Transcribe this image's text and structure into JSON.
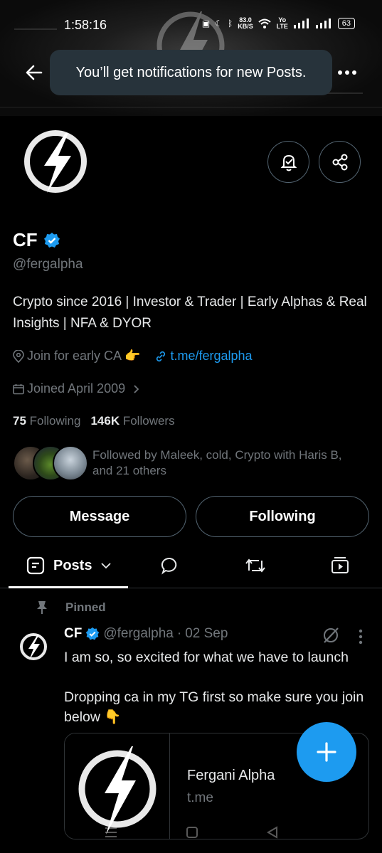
{
  "status_bar": {
    "time": "1:58:16",
    "net_speed": "83.0",
    "net_unit": "KB/S",
    "volte": "Yo LTE",
    "battery": "63"
  },
  "toast": {
    "message": "You’ll get notifications for new Posts."
  },
  "profile": {
    "name": "CF",
    "handle": "@fergalpha",
    "bio": "Crypto since 2016 | Investor & Trader | Early Alphas & Real Insights | NFA & DYOR",
    "location": "Join for early CA 👉",
    "website": "t.me/fergalpha",
    "joined": "Joined April 2009",
    "following_count": "75",
    "following_label": "Following",
    "followers_count": "146K",
    "followers_label": "Followers",
    "followed_by": "Followed by Maleek, cold, Crypto with Haris B, and 21 others"
  },
  "actions": {
    "message_label": "Message",
    "following_label": "Following"
  },
  "tabs": {
    "posts_label": "Posts"
  },
  "pinned_post": {
    "pinned_label": "Pinned",
    "author_name": "CF",
    "author_handle": "@fergalpha",
    "separator": "·",
    "date": "02 Sep",
    "text_line1": "I am so, so excited for what we have to launch",
    "text_line2": "Dropping ca in my TG first so make sure you join below 👇",
    "card_title": "Fergani Alpha",
    "card_domain": "t.me"
  },
  "colors": {
    "accent": "#1d9bf0",
    "background": "#000000",
    "muted": "#71767b",
    "border": "#2f3336"
  }
}
